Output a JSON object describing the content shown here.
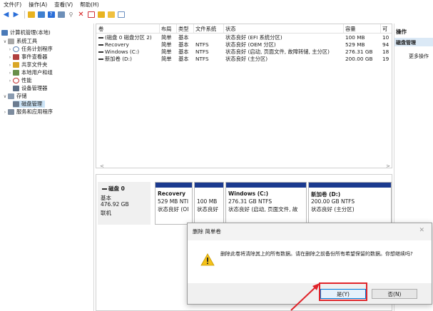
{
  "menubar": [
    "文件(F)",
    "操作(A)",
    "查看(V)",
    "帮助(H)"
  ],
  "toolbar": {
    "icons": [
      "back-arrow-icon",
      "forward-arrow-icon",
      "folder-up-icon",
      "console-tree-icon",
      "help-icon",
      "properties-icon",
      "key-icon",
      "delete-icon",
      "check-icon",
      "folder-icon",
      "refresh-icon",
      "list-view-icon"
    ],
    "colors": {
      "blue": "#2a6ed8",
      "red": "#d41a1a",
      "yellow": "#e8b320",
      "green": "#3a9d3a"
    }
  },
  "tree": {
    "root": "计算机管理(本地)",
    "system_tools": "系统工具",
    "task_scheduler": "任务计划程序",
    "event_viewer": "事件查看器",
    "shared_folders": "共享文件夹",
    "local_users": "本地用户和组",
    "performance": "性能",
    "device_manager": "设备管理器",
    "storage": "存储",
    "disk_management": "磁盘管理",
    "services_apps": "服务和应用程序"
  },
  "volumes": {
    "headers": [
      "卷",
      "布局",
      "类型",
      "文件系统",
      "状态",
      "容量",
      "可"
    ],
    "rows": [
      {
        "name": "(磁盘 0 磁盘分区 2)",
        "layout": "简单",
        "type": "基本",
        "fs": "",
        "status": "状态良好 (EFI 系统分区)",
        "capacity": "100 MB",
        "free": "10"
      },
      {
        "name": "Recovery",
        "layout": "简单",
        "type": "基本",
        "fs": "NTFS",
        "status": "状态良好 (OEM 分区)",
        "capacity": "529 MB",
        "free": "94"
      },
      {
        "name": "Windows (C:)",
        "layout": "简单",
        "type": "基本",
        "fs": "NTFS",
        "status": "状态良好 (启动, 页面文件, 故障转储, 主分区)",
        "capacity": "276.31 GB",
        "free": "18"
      },
      {
        "name": "新加卷 (D:)",
        "layout": "简单",
        "type": "基本",
        "fs": "NTFS",
        "status": "状态良好 (主分区)",
        "capacity": "200.00 GB",
        "free": "19"
      }
    ]
  },
  "actions": {
    "title": "操作",
    "section": "磁盘管理",
    "more": "更多操作"
  },
  "disk": {
    "name": "磁盘 0",
    "type": "基本",
    "size": "476.92 GB",
    "status": "联机",
    "partitions": [
      {
        "title": "Recovery",
        "line1": "529 MB NTI",
        "line2": "状态良好 (OI"
      },
      {
        "title": "",
        "line1": "100 MB",
        "line2": "状态良好"
      },
      {
        "title": "Windows (C:)",
        "line1": "276.31 GB NTFS",
        "line2": "状态良好 (启动, 页面文件, 故"
      },
      {
        "title": "新加卷 (D:)",
        "line1": "200.00 GB NTFS",
        "line2": "状态良好 (主分区)"
      }
    ],
    "bar_color": "#1b3a8f"
  },
  "dialog": {
    "title": "删除 简单卷",
    "message": "删除此卷将清除其上的所有数据。请在删除之前备份所有希望保留的数据。你想继续吗?",
    "yes": "是(Y)",
    "no": "否(N)"
  },
  "highlight_color": "#e0242a"
}
